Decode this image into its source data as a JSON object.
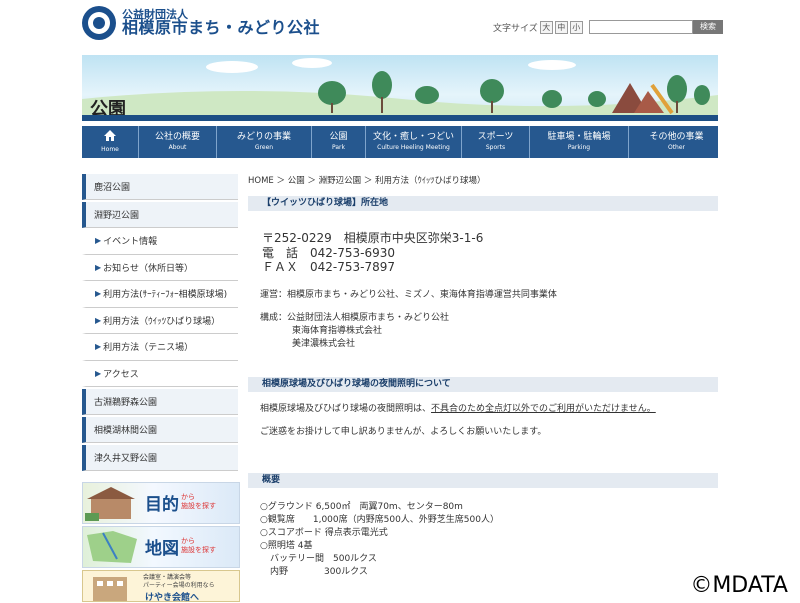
{
  "header": {
    "org_type": "公益財団法人",
    "org_name": "相模原市まち・みどり公社",
    "font_size_label": "文字サイズ",
    "font_size_large": "大",
    "font_size_medium": "中",
    "font_size_small": "小",
    "search_placeholder": "",
    "search_button": "検索"
  },
  "banner": {
    "title": "公園"
  },
  "nav": [
    {
      "label": "",
      "sub": "Home"
    },
    {
      "label": "公社の概要",
      "sub": "About"
    },
    {
      "label": "みどりの事業",
      "sub": "Green"
    },
    {
      "label": "公園",
      "sub": "Park"
    },
    {
      "label": "文化・癒し・つどい",
      "sub": "Culture  Heeling  Meeting"
    },
    {
      "label": "スポーツ",
      "sub": "Sports"
    },
    {
      "label": "駐車場・駐輪場",
      "sub": "Parking"
    },
    {
      "label": "その他の事業",
      "sub": "Other"
    }
  ],
  "sidebar": [
    "鹿沼公園",
    "淵野辺公園",
    "イベント情報",
    "お知らせ（休所日等）",
    "利用方法(ｻｰﾃｨｰﾌｫｰ相模原球場)",
    "利用方法（ｳｲｯﾂひばり球場）",
    "利用方法（テニス場）",
    "アクセス",
    "古淵鵜野森公園",
    "相模湖林間公園",
    "津久井又野公園"
  ],
  "promo": [
    {
      "title": "目的",
      "small1": "から",
      "small2": "施設を探す"
    },
    {
      "title": "地図",
      "small1": "から",
      "small2": "施設を探す"
    },
    {
      "title": "けやき会館へ",
      "small1": "会議室・講演会等",
      "small2": "パーティー会場の利用なら"
    }
  ],
  "main": {
    "breadcrumb": "HOME ＞ 公園 ＞ 淵野辺公園 ＞ 利用方法（ｳｲｯﾂひばり球場）",
    "sec1_title": "【ウイッツひばり球場】所在地",
    "postal": "〒252-0229　相模原市中央区弥栄3-1-6",
    "tel": "電　話　042-753-6930",
    "fax": "ＦＡＸ　042-753-7897",
    "operator": "運営：相模原市まち・みどり公社、ミズノ、東海体育指導運営共同事業体",
    "members1": "構成：公益財団法人相模原市まち・みどり公社",
    "members2": "東海体育指導株式会社",
    "members3": "美津濃株式会社",
    "sec2_title": "相模原球場及びひばり球場の夜間照明について",
    "notice_pre": "相模原球場及びひばり球場の夜間照明は、",
    "notice_link": "不具合のため全点灯以外でのご利用がいただけません。",
    "apology": "ご迷惑をお掛けして申し訳ありませんが、よろしくお願いいたします。",
    "sec3_title": "概要",
    "ov1": "○グラウンド 6,500㎡　両翼70m、センター80m",
    "ov2": "○観覧席　　1,000席（内野席500人、外野芝生席500人）",
    "ov3": "○スコアボード 得点表示電光式",
    "ov4": "○照明塔 4基",
    "ov5": "バッテリー間　500ルクス",
    "ov6": "内野　　　　300ルクス"
  },
  "watermark": "©MDATA"
}
